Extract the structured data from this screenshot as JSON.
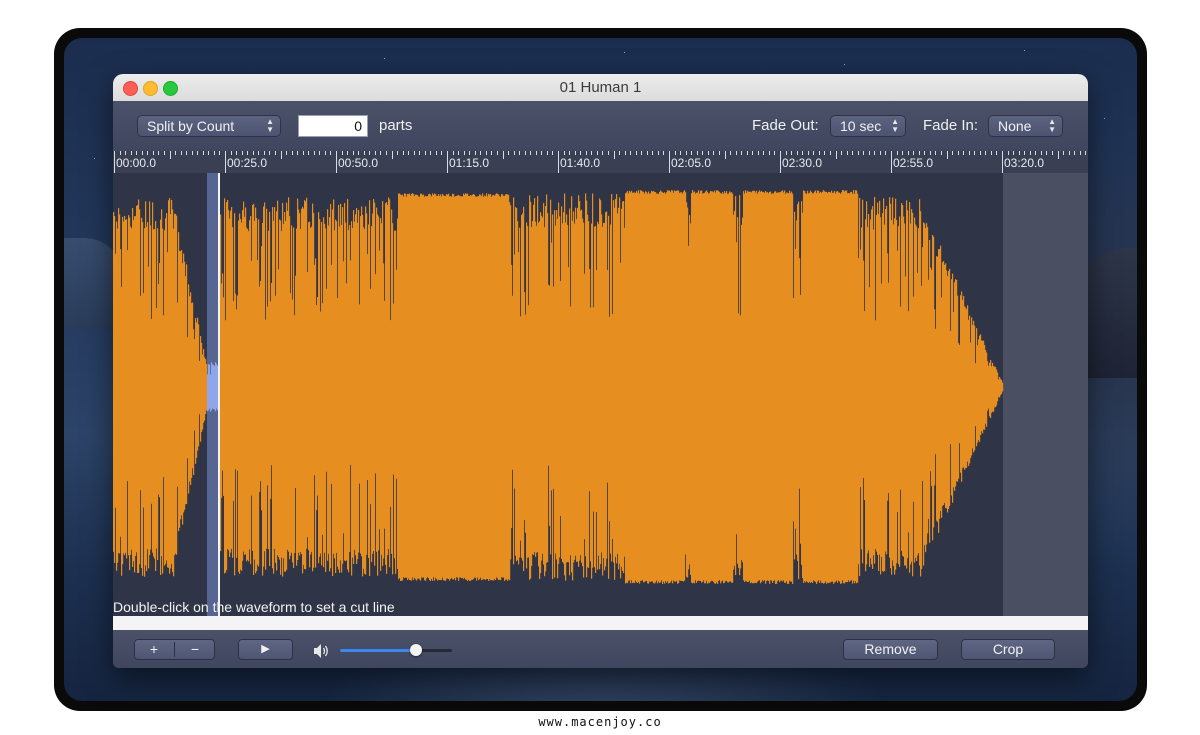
{
  "window": {
    "title": "01 Human 1"
  },
  "toolbar": {
    "split_mode": "Split by Count",
    "count_value": "0",
    "count_unit": "parts",
    "fade_out_label": "Fade Out:",
    "fade_out_value": "10 sec",
    "fade_in_label": "Fade In:",
    "fade_in_value": "None",
    "popup_arrows_icon": "updown-chevron-icon"
  },
  "timeline": {
    "labels": [
      "00:00.0",
      "00:25.0",
      "00:50.0",
      "01:15.0",
      "01:40.0",
      "02:05.0",
      "02:30.0",
      "02:55.0",
      "03:20.0"
    ]
  },
  "waveform": {
    "hint": "Double-click on the waveform to set a cut line",
    "wave_color": "#e68e1f",
    "selection_color": "#566592",
    "background_color": "#2f3446"
  },
  "controls": {
    "zoom_in": "+",
    "zoom_out": "−",
    "play": "▶",
    "volume_level": 0.68,
    "remove_label": "Remove",
    "crop_label": "Crop",
    "accent_color": "#3f86f5"
  },
  "watermark": "www.macenjoy.co"
}
